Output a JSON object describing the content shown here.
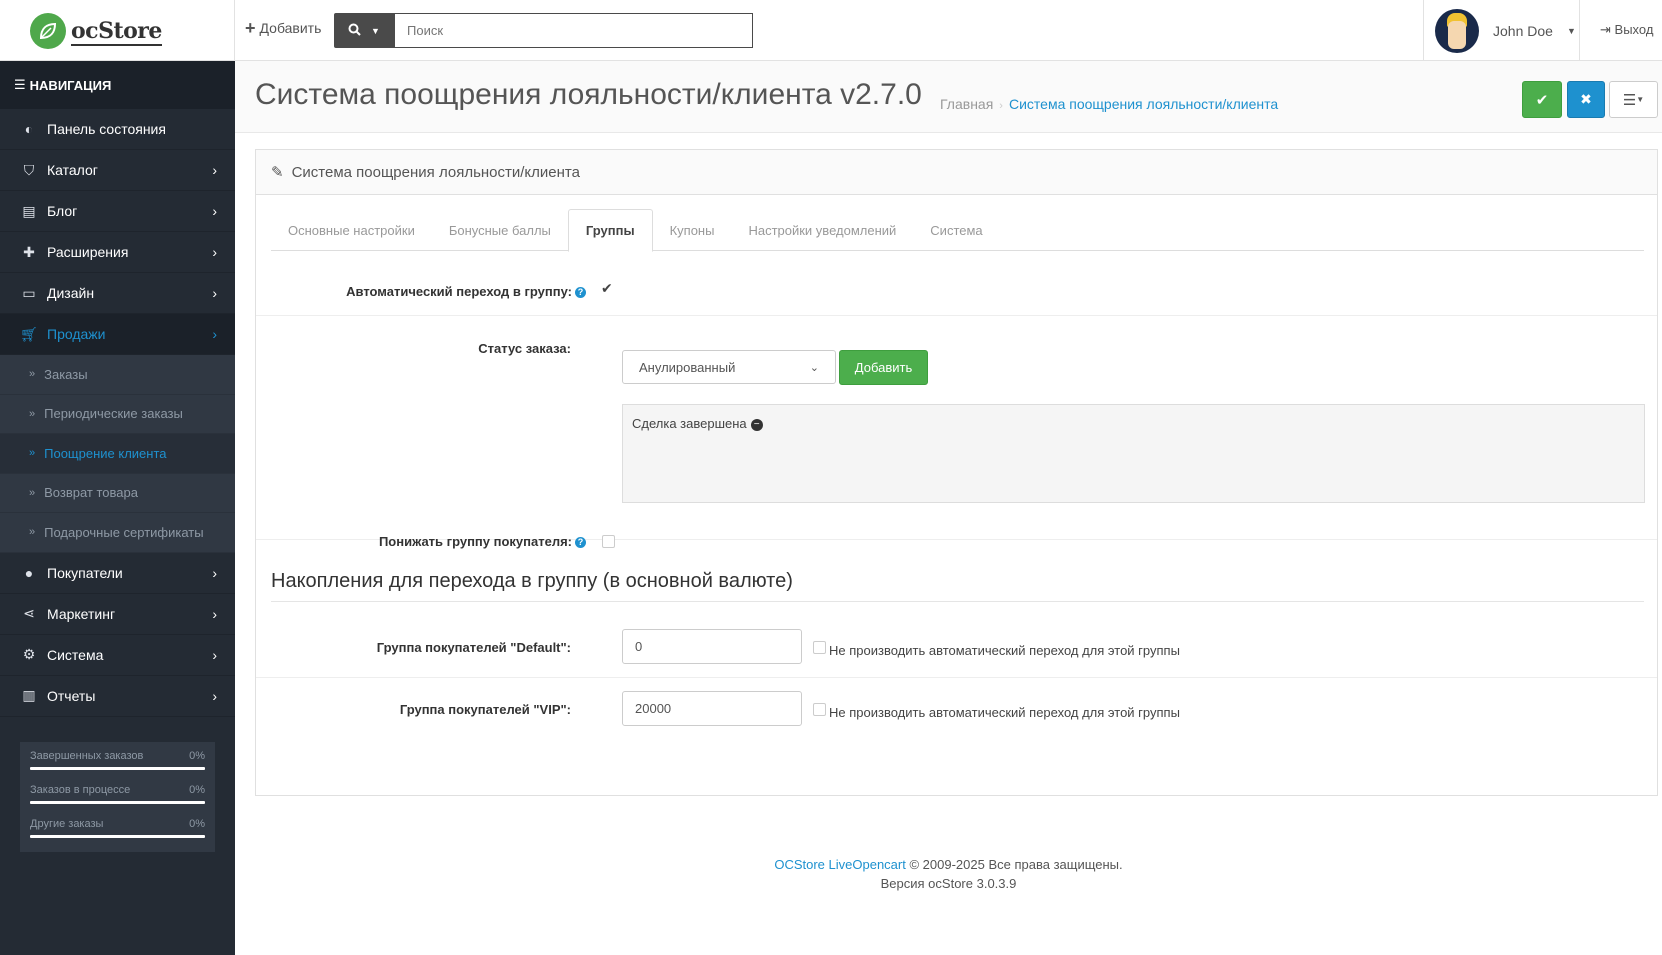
{
  "header": {
    "logo_text": "ocStore",
    "add_label": "Добавить",
    "search_placeholder": "Поиск",
    "user_name": "John Doe",
    "logout_label": "Выход"
  },
  "sidebar": {
    "title": "НАВИГАЦИЯ",
    "items": [
      {
        "label": "Панель состояния",
        "icon": "dashboard-icon"
      },
      {
        "label": "Каталог",
        "icon": "tags-icon"
      },
      {
        "label": "Блог",
        "icon": "book-icon"
      },
      {
        "label": "Расширения",
        "icon": "puzzle-icon"
      },
      {
        "label": "Дизайн",
        "icon": "monitor-icon"
      },
      {
        "label": "Продажи",
        "icon": "cart-icon"
      },
      {
        "label": "Покупатели",
        "icon": "user-icon"
      },
      {
        "label": "Маркетинг",
        "icon": "share-icon"
      },
      {
        "label": "Система",
        "icon": "gear-icon"
      },
      {
        "label": "Отчеты",
        "icon": "bar-chart-icon"
      }
    ],
    "sub_items": [
      {
        "label": "Заказы"
      },
      {
        "label": "Периодические заказы"
      },
      {
        "label": "Поощрение клиента"
      },
      {
        "label": "Возврат товара"
      },
      {
        "label": "Подарочные сертификаты"
      }
    ],
    "stats": [
      {
        "label": "Завершенных заказов",
        "value": "0%"
      },
      {
        "label": "Заказов в процессе",
        "value": "0%"
      },
      {
        "label": "Другие заказы",
        "value": "0%"
      }
    ]
  },
  "page": {
    "title": "Система поощрения лояльности/клиента v2.7.0",
    "breadcrumb_home": "Главная",
    "breadcrumb_current": "Система поощрения лояльности/клиента",
    "panel_title": "Система поощрения лояльности/клиента"
  },
  "tabs": [
    {
      "label": "Основные настройки"
    },
    {
      "label": "Бонусные баллы"
    },
    {
      "label": "Группы"
    },
    {
      "label": "Купоны"
    },
    {
      "label": "Настройки уведомлений"
    },
    {
      "label": "Система"
    }
  ],
  "form": {
    "auto_transition_label": "Автоматический переход в группу:",
    "order_status_label": "Статус заказа:",
    "order_status_value": "Анулированный",
    "add_button": "Добавить",
    "status_tag": "Сделка завершена",
    "demote_label": "Понижать группу покупателя:",
    "section_title": "Накопления для перехода в группу (в основной валюте)",
    "groups": [
      {
        "label": "Группа покупателей \"Default\":",
        "value": "0",
        "check_label": "Не производить автоматический переход для этой группы"
      },
      {
        "label": "Группа покупателей \"VIP\":",
        "value": "20000",
        "check_label": "Не производить автоматический переход для этой группы"
      }
    ]
  },
  "footer": {
    "link": "OCStore LiveOpencart",
    "copyright": "© 2009-2025 Все права защищены.",
    "version": "Версия ocStore 3.0.3.9"
  }
}
